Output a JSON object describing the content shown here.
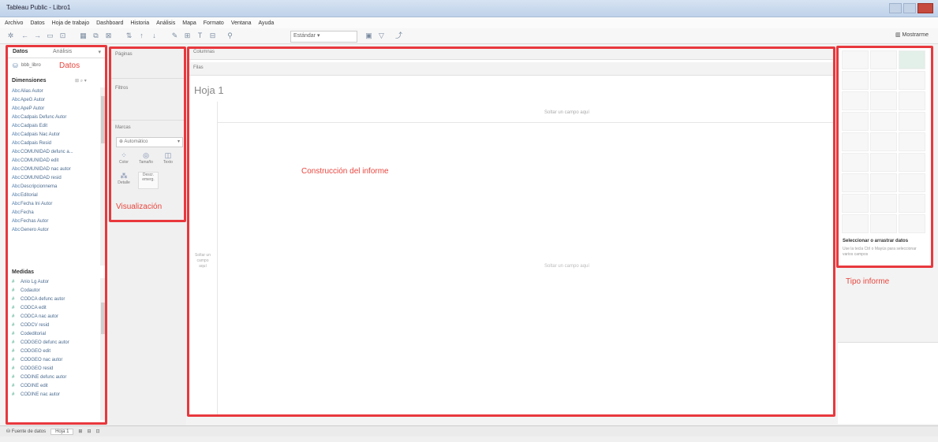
{
  "window": {
    "title": "Tableau Public - Libro1"
  },
  "menu": [
    "Archivo",
    "Datos",
    "Hoja de trabajo",
    "Dashboard",
    "Historia",
    "Análisis",
    "Mapa",
    "Formato",
    "Ventana",
    "Ayuda"
  ],
  "toolbar": {
    "fit": "Estándar",
    "show_me": "Mostrarme"
  },
  "data_panel": {
    "tab_data": "Datos",
    "tab_analysis": "Análisis",
    "data_source": "bbb_libro",
    "annotation": "Datos",
    "dimensions_header": "Dimensiones",
    "dimensions": [
      "Alias Autor",
      "ApeG Autor",
      "ApeP Autor",
      "Cadpais Defunc Autor",
      "Cadpais Edit",
      "Cadpais Nac Autor",
      "Cadpais Resid",
      "COMUNIDAD defunc a...",
      "COMUNIDAD edit",
      "COMUNIDAD nac autor",
      "COMUNIDAD resid",
      "Descripcionnema",
      "Editorial",
      "Fecha Ini Autor",
      "Fecha",
      "Fechas Autor",
      "Genero Autor"
    ],
    "measures_header": "Medidas",
    "measures": [
      "Anio Lg Autor",
      "Codautor",
      "CODCA defunc autor",
      "CODCA edit",
      "CODCA nac autor",
      "CODCV resid",
      "Codeditorial",
      "CODGEO defunc autor",
      "CODGEO edit",
      "CODGEO nac autor",
      "CODGEO resid",
      "CODINE defunc autor",
      "CODINE edit",
      "CODINE nac autor"
    ]
  },
  "shelves": {
    "pages": "Páginas",
    "filters": "Filtros",
    "marks": "Marcas",
    "mark_type": "Automático",
    "mark_buttons": [
      "Color",
      "Tamaño",
      "Texto",
      "Detalle",
      "Descr. emerg."
    ],
    "annotation": "Visualización"
  },
  "canvas": {
    "columns": "Columnas",
    "rows": "Filas",
    "sheet_title": "Hoja 1",
    "drop_field_top": "Soltar un campo aquí",
    "drop_field_center": "Soltar un campo aquí",
    "drop_field_left": "Soltar un campo aquí",
    "annotation": "Construcción del informe"
  },
  "show_me": {
    "header": "Seleccionar o arrastrar datos",
    "description": "Use la tecla Ctrl o Mayús para seleccionar varios campos",
    "annotation": "Tipo informe"
  },
  "tabs": {
    "data_source": "Fuente de datos",
    "sheet": "Hoja 1"
  },
  "colors": {
    "annotation": "#e8383d",
    "title_bar": "#c9daf0",
    "close_button": "#c64a3e"
  }
}
